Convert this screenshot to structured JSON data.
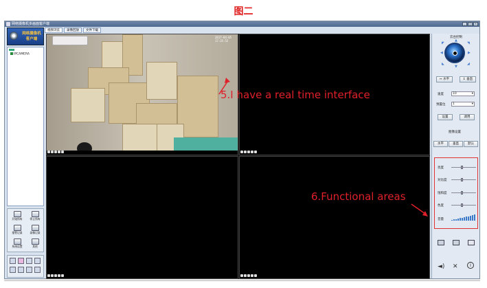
{
  "caption": "图二",
  "window": {
    "title": "网络摄像机多画面客户端",
    "minimize": "_",
    "maximize": "□",
    "close": "×"
  },
  "tabs": [
    {
      "label": "视频浏览",
      "active": true
    },
    {
      "label": "录像回放",
      "active": false
    },
    {
      "label": "文件下载",
      "active": false
    }
  ],
  "logo": {
    "line1": "网络摄像机",
    "line2": "客户端"
  },
  "device_tree": {
    "node_label": "IPCAMERA"
  },
  "left_buttons": [
    {
      "label": "开始所有",
      "icon": "start-all-icon"
    },
    {
      "label": "停止所有",
      "icon": "stop-all-icon"
    },
    {
      "label": "报警记录",
      "icon": "alarm-log-icon"
    },
    {
      "label": "录像记录",
      "icon": "record-log-icon"
    },
    {
      "label": "系统设置",
      "icon": "settings-icon"
    },
    {
      "label": "其他",
      "icon": "other-icon"
    }
  ],
  "video": {
    "timestamp": "2017-04-05 17:35:52",
    "annotation_top": "5.I have a real time interface",
    "annotation_bottom": "6.Functional areas"
  },
  "ptz": {
    "title": "云台控制",
    "horizontal_label": "水平",
    "vertical_label": "垂直",
    "speed_label": "速度",
    "speed_value": "10",
    "preset_label": "预置位",
    "preset_value": "1",
    "set_label": "设置",
    "call_label": "调用",
    "image_settings_label": "图像设置",
    "mirror_h_label": "水平",
    "mirror_v_label": "垂直",
    "default_label": "默认"
  },
  "image_settings": {
    "brightness_label": "亮度",
    "contrast_label": "对比度",
    "saturation_label": "饱和度",
    "hue_label": "色度",
    "volume_label": "音量"
  },
  "colors": {
    "annotation": "#e0202a",
    "highlight_border": "#e03030",
    "accent": "#2a70c8"
  }
}
